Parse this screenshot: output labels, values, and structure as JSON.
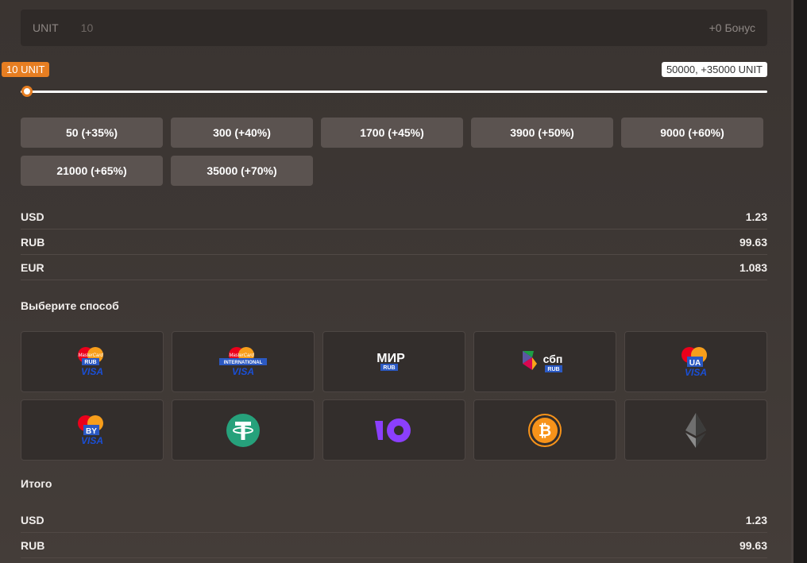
{
  "amount": {
    "unit_label": "UNIT",
    "value": "10",
    "bonus": "+0 Бонус"
  },
  "slider": {
    "min_label": "10 UNIT",
    "max_label": "50000, +35000 UNIT",
    "level_fraction": 0.0
  },
  "presets": [
    "50 (+35%)",
    "300 (+40%)",
    "1700 (+45%)",
    "3900 (+50%)",
    "9000 (+60%)",
    "21000 (+65%)",
    "35000 (+70%)"
  ],
  "rates": [
    {
      "currency": "USD",
      "value": "1.23"
    },
    {
      "currency": "RUB",
      "value": "99.63"
    },
    {
      "currency": "EUR",
      "value": "1.083"
    }
  ],
  "method_section_title": "Выберите способ",
  "methods": [
    {
      "icon": "mastercard-visa-rub-icon",
      "badge": "RUB",
      "mc_text": "MasterCard",
      "visa_text": "VISA"
    },
    {
      "icon": "mastercard-visa-international-icon",
      "badge": "INTERNATIONAL",
      "mc_text": "MasterCard",
      "visa_text": "VISA"
    },
    {
      "icon": "mir-rub-icon",
      "brand": "МИР",
      "badge": "RUB"
    },
    {
      "icon": "sbp-rub-icon",
      "brand": "сбп",
      "badge": "RUB"
    },
    {
      "icon": "mastercard-visa-ua-icon",
      "badge": "UA",
      "mc_text": "MasterCard",
      "visa_text": "VISA"
    },
    {
      "icon": "mastercard-visa-by-icon",
      "badge": "BY",
      "mc_text": "MasterCard",
      "visa_text": "VISA"
    },
    {
      "icon": "tether-icon"
    },
    {
      "icon": "yoomoney-icon"
    },
    {
      "icon": "bitcoin-icon"
    },
    {
      "icon": "ethereum-icon"
    }
  ],
  "total_title": "Итого",
  "totals": [
    {
      "currency": "USD",
      "value": "1.23"
    },
    {
      "currency": "RUB",
      "value": "99.63"
    }
  ],
  "colors": {
    "accent": "#e67e22",
    "button_bg": "#5b5350",
    "tether": "#26a17b",
    "yoomoney": "#8b3ffd",
    "bitcoin": "#f7931a",
    "badge_blue": "#2b59c3"
  }
}
